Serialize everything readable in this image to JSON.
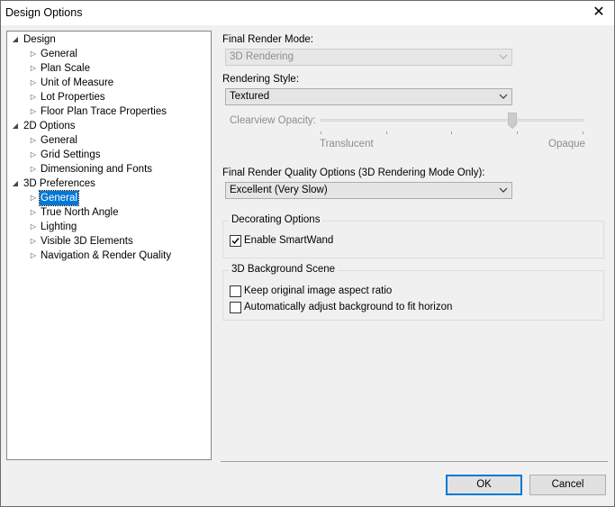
{
  "window": {
    "title": "Design Options",
    "close_glyph": "✕"
  },
  "tree": {
    "items": [
      {
        "label": "Design",
        "level": 0,
        "expanded": true
      },
      {
        "label": "General",
        "level": 1
      },
      {
        "label": "Plan Scale",
        "level": 1
      },
      {
        "label": "Unit of Measure",
        "level": 1
      },
      {
        "label": "Lot Properties",
        "level": 1
      },
      {
        "label": "Floor Plan Trace Properties",
        "level": 1
      },
      {
        "label": "2D Options",
        "level": 0,
        "expanded": true
      },
      {
        "label": "General",
        "level": 1
      },
      {
        "label": "Grid Settings",
        "level": 1
      },
      {
        "label": "Dimensioning and Fonts",
        "level": 1
      },
      {
        "label": "3D Preferences",
        "level": 0,
        "expanded": true
      },
      {
        "label": "General",
        "level": 1,
        "selected": true
      },
      {
        "label": "True North Angle",
        "level": 1
      },
      {
        "label": "Lighting",
        "level": 1
      },
      {
        "label": "Visible 3D Elements",
        "level": 1
      },
      {
        "label": "Navigation & Render Quality",
        "level": 1
      }
    ],
    "selected_color": "#0078d7"
  },
  "settings": {
    "final_render_mode": {
      "label": "Final Render Mode:",
      "value": "3D Rendering",
      "enabled": false
    },
    "rendering_style": {
      "label": "Rendering Style:",
      "value": "Textured",
      "enabled": true
    },
    "clearview_opacity": {
      "label": "Clearview Opacity:",
      "min_label": "Translucent",
      "max_label": "Opaque",
      "value_fraction": 0.73,
      "enabled": false
    },
    "quality": {
      "label": "Final Render Quality Options (3D Rendering Mode Only):",
      "value": "Excellent (Very Slow)"
    }
  },
  "decorating": {
    "title": "Decorating Options",
    "enable_smartwand": {
      "label": "Enable SmartWand",
      "checked": true
    }
  },
  "background": {
    "title": "3D Background Scene",
    "keep_aspect": {
      "label": "Keep original image aspect ratio",
      "checked": false
    },
    "auto_adjust": {
      "label": "Automatically adjust background to fit horizon",
      "checked": false
    }
  },
  "buttons": {
    "ok": "OK",
    "cancel": "Cancel"
  }
}
